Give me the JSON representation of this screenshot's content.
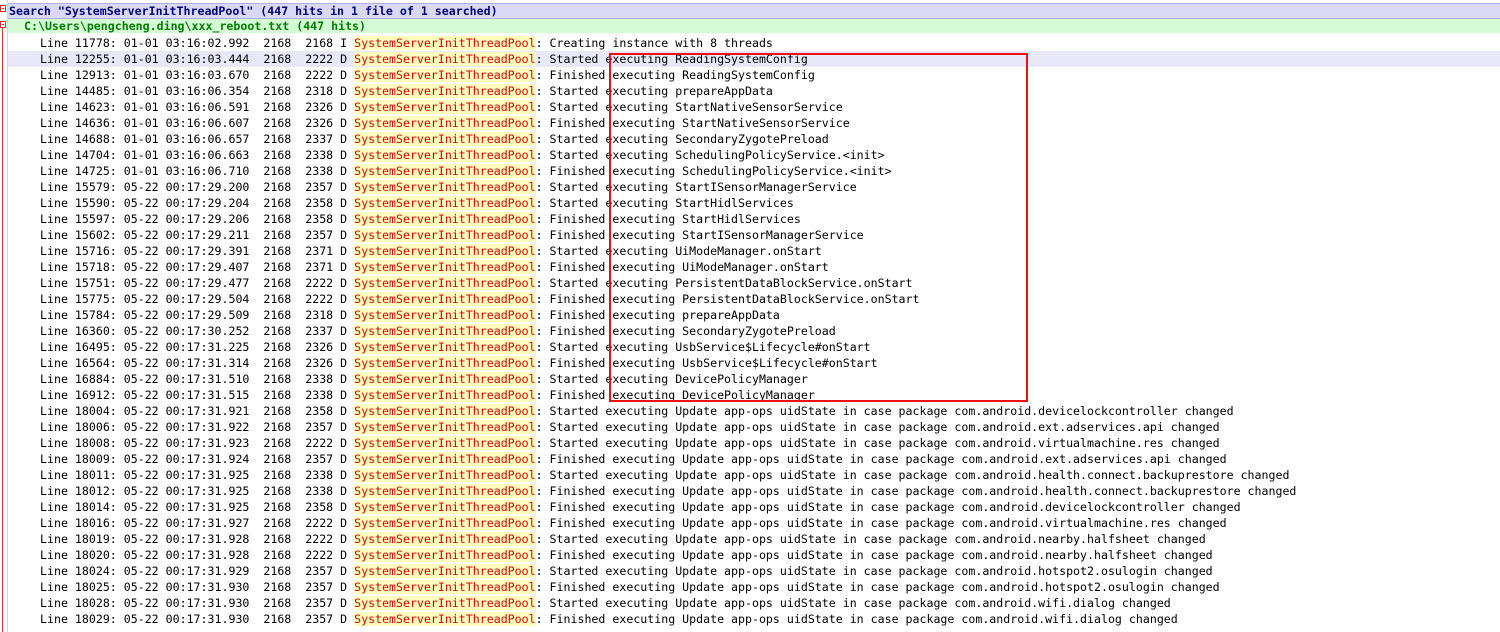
{
  "search_header": "Search \"SystemServerInitThreadPool\" (447 hits in 1 file of 1 searched)",
  "file_header": "C:\\Users\\pengcheng.ding\\xxx_reboot.txt (447 hits)",
  "search_term": "SystemServerInitThreadPool",
  "selected_index": 1,
  "colors": {
    "search_header_bg": "#d9d9f6",
    "file_header_bg": "#d5fad5",
    "match_text": "#e00000",
    "match_bg": "#ffffbe",
    "highlight_box": "#ee1111"
  },
  "lines": [
    {
      "prefix": "Line 11778: 01-01 03:16:02.992  2168  2168 I ",
      "rest": ": Creating instance with 8 threads"
    },
    {
      "prefix": "Line 12255: 01-01 03:16:03.444  2168  2222 D ",
      "rest": ": Started executing ReadingSystemConfig"
    },
    {
      "prefix": "Line 12913: 01-01 03:16:03.670  2168  2222 D ",
      "rest": ": Finished executing ReadingSystemConfig"
    },
    {
      "prefix": "Line 14485: 01-01 03:16:06.354  2168  2318 D ",
      "rest": ": Started executing prepareAppData"
    },
    {
      "prefix": "Line 14623: 01-01 03:16:06.591  2168  2326 D ",
      "rest": ": Started executing StartNativeSensorService"
    },
    {
      "prefix": "Line 14636: 01-01 03:16:06.607  2168  2326 D ",
      "rest": ": Finished executing StartNativeSensorService"
    },
    {
      "prefix": "Line 14688: 01-01 03:16:06.657  2168  2337 D ",
      "rest": ": Started executing SecondaryZygotePreload"
    },
    {
      "prefix": "Line 14704: 01-01 03:16:06.663  2168  2338 D ",
      "rest": ": Started executing SchedulingPolicyService.<init>"
    },
    {
      "prefix": "Line 14725: 01-01 03:16:06.710  2168  2338 D ",
      "rest": ": Finished executing SchedulingPolicyService.<init>"
    },
    {
      "prefix": "Line 15579: 05-22 00:17:29.200  2168  2357 D ",
      "rest": ": Started executing StartISensorManagerService"
    },
    {
      "prefix": "Line 15590: 05-22 00:17:29.204  2168  2358 D ",
      "rest": ": Started executing StartHidlServices"
    },
    {
      "prefix": "Line 15597: 05-22 00:17:29.206  2168  2358 D ",
      "rest": ": Finished executing StartHidlServices"
    },
    {
      "prefix": "Line 15602: 05-22 00:17:29.211  2168  2357 D ",
      "rest": ": Finished executing StartISensorManagerService"
    },
    {
      "prefix": "Line 15716: 05-22 00:17:29.391  2168  2371 D ",
      "rest": ": Started executing UiModeManager.onStart"
    },
    {
      "prefix": "Line 15718: 05-22 00:17:29.407  2168  2371 D ",
      "rest": ": Finished executing UiModeManager.onStart"
    },
    {
      "prefix": "Line 15751: 05-22 00:17:29.477  2168  2222 D ",
      "rest": ": Started executing PersistentDataBlockService.onStart"
    },
    {
      "prefix": "Line 15775: 05-22 00:17:29.504  2168  2222 D ",
      "rest": ": Finished executing PersistentDataBlockService.onStart"
    },
    {
      "prefix": "Line 15784: 05-22 00:17:29.509  2168  2318 D ",
      "rest": ": Finished executing prepareAppData"
    },
    {
      "prefix": "Line 16360: 05-22 00:17:30.252  2168  2337 D ",
      "rest": ": Finished executing SecondaryZygotePreload"
    },
    {
      "prefix": "Line 16495: 05-22 00:17:31.225  2168  2326 D ",
      "rest": ": Started executing UsbService$Lifecycle#onStart"
    },
    {
      "prefix": "Line 16564: 05-22 00:17:31.314  2168  2326 D ",
      "rest": ": Finished executing UsbService$Lifecycle#onStart"
    },
    {
      "prefix": "Line 16884: 05-22 00:17:31.510  2168  2338 D ",
      "rest": ": Started executing DevicePolicyManager"
    },
    {
      "prefix": "Line 16912: 05-22 00:17:31.515  2168  2338 D ",
      "rest": ": Finished executing DevicePolicyManager"
    },
    {
      "prefix": "Line 18004: 05-22 00:17:31.921  2168  2358 D ",
      "rest": ": Started executing Update app-ops uidState in case package com.android.devicelockcontroller changed"
    },
    {
      "prefix": "Line 18006: 05-22 00:17:31.922  2168  2357 D ",
      "rest": ": Started executing Update app-ops uidState in case package com.android.ext.adservices.api changed"
    },
    {
      "prefix": "Line 18008: 05-22 00:17:31.923  2168  2222 D ",
      "rest": ": Started executing Update app-ops uidState in case package com.android.virtualmachine.res changed"
    },
    {
      "prefix": "Line 18009: 05-22 00:17:31.924  2168  2357 D ",
      "rest": ": Finished executing Update app-ops uidState in case package com.android.ext.adservices.api changed"
    },
    {
      "prefix": "Line 18011: 05-22 00:17:31.925  2168  2338 D ",
      "rest": ": Started executing Update app-ops uidState in case package com.android.health.connect.backuprestore changed"
    },
    {
      "prefix": "Line 18012: 05-22 00:17:31.925  2168  2338 D ",
      "rest": ": Finished executing Update app-ops uidState in case package com.android.health.connect.backuprestore changed"
    },
    {
      "prefix": "Line 18014: 05-22 00:17:31.925  2168  2358 D ",
      "rest": ": Finished executing Update app-ops uidState in case package com.android.devicelockcontroller changed"
    },
    {
      "prefix": "Line 18016: 05-22 00:17:31.927  2168  2222 D ",
      "rest": ": Finished executing Update app-ops uidState in case package com.android.virtualmachine.res changed"
    },
    {
      "prefix": "Line 18019: 05-22 00:17:31.928  2168  2222 D ",
      "rest": ": Started executing Update app-ops uidState in case package com.android.nearby.halfsheet changed"
    },
    {
      "prefix": "Line 18020: 05-22 00:17:31.928  2168  2222 D ",
      "rest": ": Finished executing Update app-ops uidState in case package com.android.nearby.halfsheet changed"
    },
    {
      "prefix": "Line 18024: 05-22 00:17:31.929  2168  2357 D ",
      "rest": ": Started executing Update app-ops uidState in case package com.android.hotspot2.osulogin changed"
    },
    {
      "prefix": "Line 18025: 05-22 00:17:31.930  2168  2357 D ",
      "rest": ": Finished executing Update app-ops uidState in case package com.android.hotspot2.osulogin changed"
    },
    {
      "prefix": "Line 18028: 05-22 00:17:31.930  2168  2357 D ",
      "rest": ": Started executing Update app-ops uidState in case package com.android.wifi.dialog changed"
    },
    {
      "prefix": "Line 18029: 05-22 00:17:31.930  2168  2357 D ",
      "rest": ": Finished executing Update app-ops uidState in case package com.android.wifi.dialog changed"
    }
  ]
}
